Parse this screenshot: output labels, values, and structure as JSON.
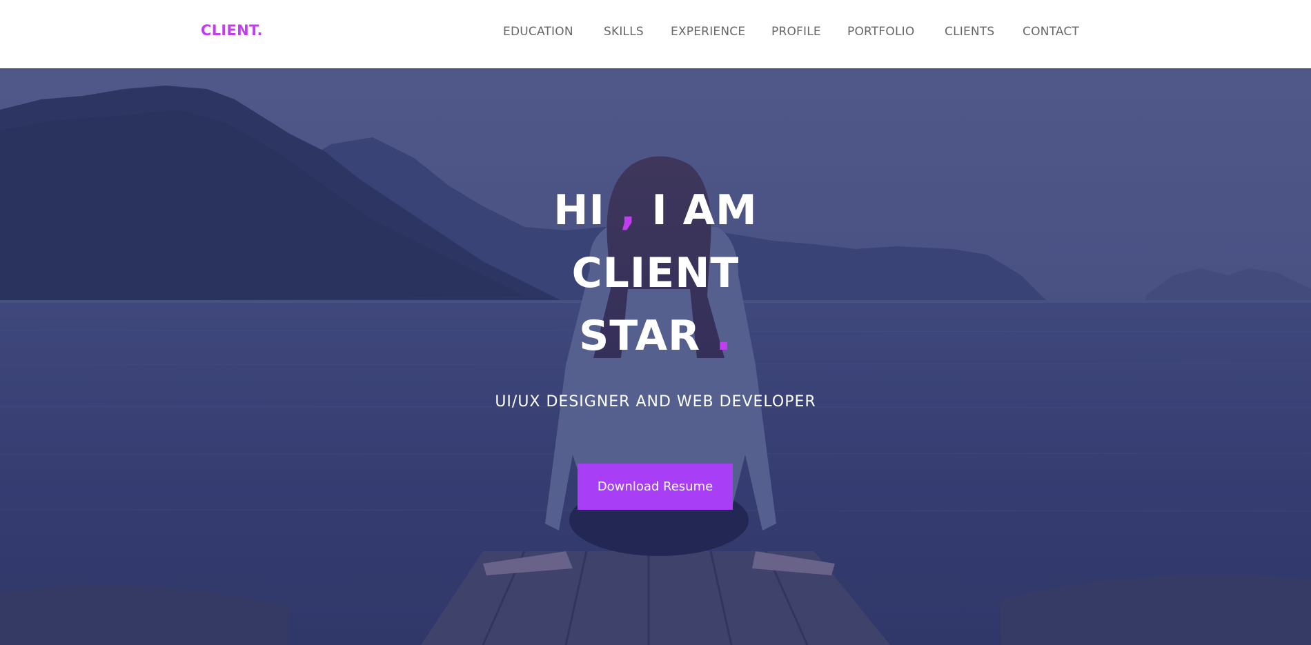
{
  "header": {
    "logo": "CLIENT.",
    "nav": [
      {
        "label": "EDUCATION"
      },
      {
        "label": "SKILLS"
      },
      {
        "label": "EXPERIENCE"
      },
      {
        "label": "PROFILE"
      },
      {
        "label": "PORTFOLIO"
      },
      {
        "label": "CLIENTS"
      },
      {
        "label": "CONTACT"
      }
    ]
  },
  "hero": {
    "line1_a": "HI ",
    "line1_comma": ",",
    "line1_b": " I AM",
    "line2": "CLIENT",
    "line3": "STAR ",
    "line3_dot": ".",
    "subtitle": "UI/UX DESIGNER AND WEB DEVELOPER",
    "cta_label": "Download Resume",
    "background_image": "woman-sitting-on-pier-by-lake"
  },
  "colors": {
    "accent": "#c13df0",
    "button": "#a83ef5",
    "nav_text": "#666666",
    "overlay": "#2c326e"
  }
}
